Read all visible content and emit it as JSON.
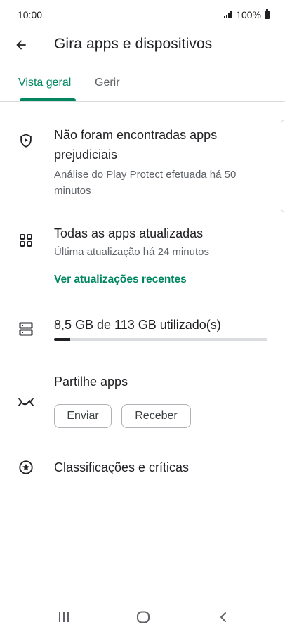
{
  "status": {
    "time": "10:00",
    "battery": "100%"
  },
  "header": {
    "title": "Gira apps e dispositivos"
  },
  "tabs": [
    {
      "label": "Vista geral",
      "active": true
    },
    {
      "label": "Gerir",
      "active": false
    }
  ],
  "protect": {
    "icon": "shield-play-icon",
    "title_line1": "Não foram encontradas apps",
    "title_line2": "prejudiciais",
    "subtitle_line1": "Análise do Play Protect efetuada há 50",
    "subtitle_line2": "minutos"
  },
  "updates": {
    "icon": "apps-grid-icon",
    "title": "Todas as apps atualizadas",
    "subtitle": "Última atualização há 24 minutos",
    "link": "Ver atualizações recentes"
  },
  "storage": {
    "icon": "storage-icon",
    "label": "8,5 GB de 113 GB utilizado(s)",
    "used_fraction": 0.075
  },
  "share": {
    "icon": "nearby-share-icon",
    "title": "Partilhe apps",
    "send_label": "Enviar",
    "receive_label": "Receber"
  },
  "ratings": {
    "icon": "star-circle-icon",
    "title": "Classificações e críticas"
  },
  "colors": {
    "accent": "#01875f",
    "text": "#202124",
    "secondary": "#5f6368",
    "divider": "#dadce0"
  }
}
